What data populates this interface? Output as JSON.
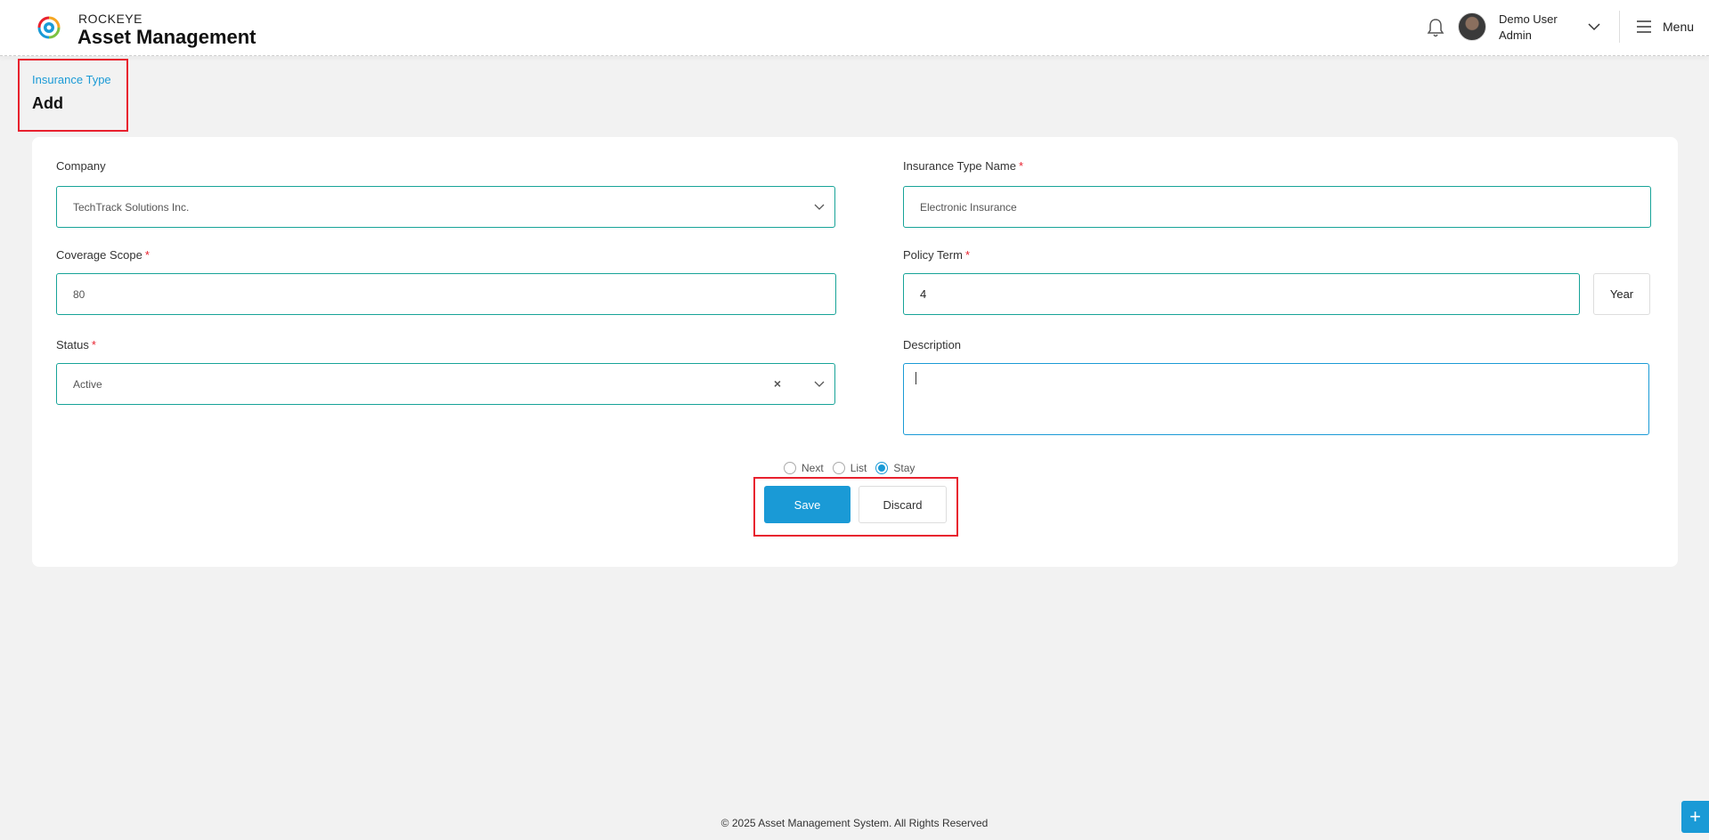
{
  "header": {
    "brand_top": "ROCKEYE",
    "brand_main": "Asset Management",
    "user_name": "Demo User",
    "user_role": "Admin",
    "menu_label": "Menu",
    "icons": [
      "logo-icon",
      "bell-icon",
      "avatar",
      "chevron-down-icon",
      "hamburger-icon"
    ]
  },
  "page": {
    "breadcrumb": "Insurance Type",
    "title": "Add"
  },
  "form": {
    "company": {
      "label": "Company",
      "value": "TechTrack Solutions Inc."
    },
    "insurance_type_name": {
      "label": "Insurance Type Name",
      "required": "*",
      "value": "Electronic Insurance"
    },
    "coverage_scope": {
      "label": "Coverage Scope",
      "required": "*",
      "value": "80"
    },
    "policy_term": {
      "label": "Policy Term",
      "required": "*",
      "value": "4",
      "unit": "Year"
    },
    "status": {
      "label": "Status",
      "required": "*",
      "value": "Active",
      "clear": "×"
    },
    "description": {
      "label": "Description",
      "value": ""
    }
  },
  "after_save": {
    "options": [
      {
        "label": "Next",
        "checked": false
      },
      {
        "label": "List",
        "checked": false
      },
      {
        "label": "Stay",
        "checked": true
      }
    ]
  },
  "actions": {
    "save_label": "Save",
    "discard_label": "Discard"
  },
  "footer": {
    "text": "© 2025 Asset Management System. All Rights Reserved",
    "fab_label": "+"
  },
  "colors": {
    "accent": "#1a9ad6",
    "field_border": "#17a398",
    "highlight": "#e8212e"
  }
}
